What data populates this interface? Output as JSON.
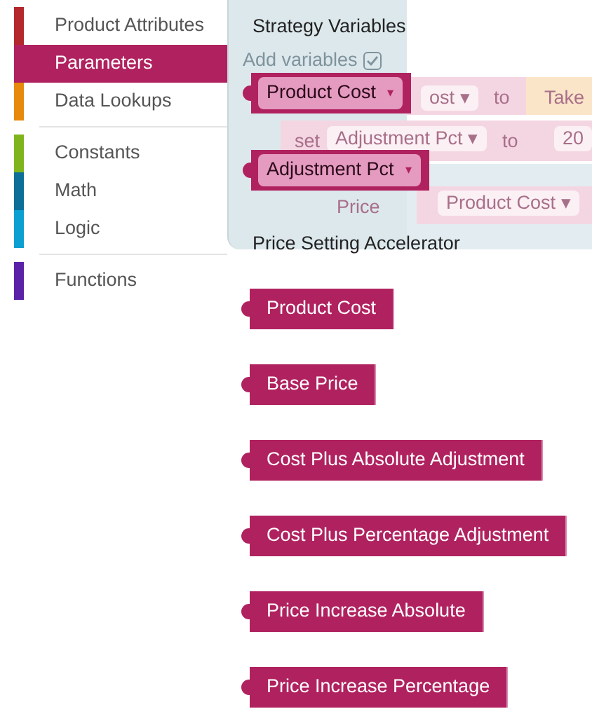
{
  "toolbox": {
    "groups": [
      [
        {
          "label": "Product Attributes",
          "color": "#b3282d",
          "selected": false
        },
        {
          "label": "Parameters",
          "color": "#b0225f",
          "selected": true
        },
        {
          "label": "Data Lookups",
          "color": "#e6890c",
          "selected": false
        }
      ],
      [
        {
          "label": "Constants",
          "color": "#80b41c",
          "selected": false
        },
        {
          "label": "Math",
          "color": "#0b6f98",
          "selected": false
        },
        {
          "label": "Logic",
          "color": "#0c9fd2",
          "selected": false
        }
      ],
      [
        {
          "label": "Functions",
          "color": "#5b22a8",
          "selected": false
        }
      ]
    ]
  },
  "workspace": {
    "items": [
      {
        "kind": "pill",
        "text": "ost",
        "caret": "▾"
      },
      {
        "kind": "label",
        "text": "to"
      },
      {
        "kind": "label",
        "text": "Take"
      },
      {
        "kind": "label",
        "text": "set"
      },
      {
        "kind": "pill",
        "text": "Adjustment Pct",
        "caret": "▾"
      },
      {
        "kind": "label",
        "text": "to"
      },
      {
        "kind": "pill",
        "text": "20"
      },
      {
        "kind": "label",
        "text": "Price"
      },
      {
        "kind": "pill",
        "text": "Product Cost",
        "caret": "▾"
      }
    ]
  },
  "flyout": {
    "heading": "Strategy Variables",
    "add_variables": {
      "label": "Add variables",
      "checked": true
    },
    "variables": [
      {
        "label": "Product Cost",
        "caret": "▾"
      },
      {
        "label": "Adjustment Pct",
        "caret": "▾"
      }
    ],
    "section": "Price Setting Accelerator",
    "blocks": [
      {
        "label": "Product Cost"
      },
      {
        "label": "Base Price"
      },
      {
        "label": "Cost Plus Absolute Adjustment"
      },
      {
        "label": "Cost Plus Percentage Adjustment"
      },
      {
        "label": "Price Increase Absolute"
      },
      {
        "label": "Price Increase Percentage"
      }
    ]
  }
}
